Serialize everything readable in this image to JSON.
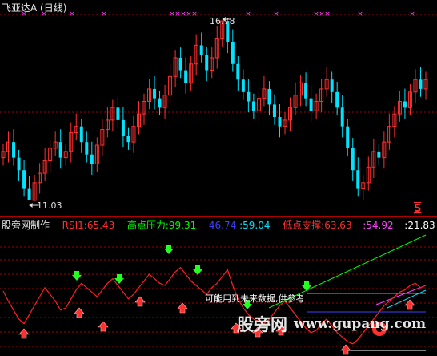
{
  "window": {
    "title": "飞亚达A (日线)"
  },
  "price_panel": {
    "high_label": "16.78",
    "low_label": "11.03",
    "s_marker": "S",
    "colors": {
      "up": "#ff3030",
      "down": "#00e5ff",
      "cross": "#ff40ff"
    }
  },
  "indicator_header": {
    "author": "股旁网制作",
    "rsi": {
      "label": "RSI1:",
      "value": "65.43",
      "color": "#ff3030"
    },
    "resist": {
      "label": "高点压力:",
      "value": "99.31",
      "color": "#00ff00"
    },
    "v3": {
      "value": "46.74",
      "color": "#4040ff"
    },
    "v4": {
      "value": ":59.04",
      "color": "#00e5ff"
    },
    "support": {
      "label": "低点支撑:",
      "value": "63.63",
      "color": "#ff3030"
    },
    "v6": {
      "value": ":54.92",
      "color": "#ff40ff"
    },
    "v7": {
      "value": ":21.83",
      "color": "#ffffff"
    }
  },
  "notice": "可能用到未来数据,供参考",
  "watermark": {
    "cn": "股旁网",
    "url": "www.gupang.com"
  },
  "chart_data": [
    {
      "type": "candlestick",
      "title": "飞亚达A (日线)",
      "annotations": [
        {
          "label": "16.78",
          "kind": "high"
        },
        {
          "label": "11.03",
          "kind": "low"
        }
      ],
      "series": [
        {
          "name": "daily",
          "values": [
            12.6,
            12.9,
            12.4,
            12.0,
            11.4,
            11.03,
            11.6,
            11.9,
            12.3,
            12.7,
            12.9,
            12.4,
            12.6,
            13.2,
            13.4,
            12.9,
            12.5,
            12.2,
            12.8,
            13.3,
            13.6,
            14.0,
            13.6,
            13.1,
            12.9,
            13.4,
            13.8,
            14.2,
            14.6,
            14.3,
            14.0,
            14.4,
            15.0,
            15.6,
            15.2,
            14.8,
            15.4,
            16.0,
            15.7,
            15.2,
            15.6,
            16.2,
            16.78,
            16.1,
            15.4,
            14.9,
            14.5,
            14.2,
            13.9,
            14.3,
            14.6,
            14.1,
            13.7,
            13.4,
            13.6,
            14.0,
            14.4,
            14.8,
            14.3,
            13.9,
            14.2,
            14.6,
            14.9,
            14.5,
            14.0,
            13.4,
            12.7,
            12.0,
            11.4,
            11.6,
            12.1,
            12.6,
            12.4,
            12.9,
            13.4,
            13.8,
            14.2,
            14.0,
            14.5,
            14.9,
            14.6,
            14.9
          ]
        }
      ]
    },
    {
      "type": "line",
      "title": "RSI1",
      "series": [
        {
          "name": "RSI1",
          "values": [
            55,
            46,
            38,
            30,
            26,
            34,
            42,
            50,
            58,
            52,
            46,
            38,
            40,
            48,
            56,
            62,
            58,
            54,
            50,
            56,
            62,
            66,
            60,
            54,
            48,
            52,
            58,
            64,
            70,
            66,
            62,
            60,
            66,
            72,
            76,
            70,
            64,
            60,
            56,
            52,
            58,
            62,
            68,
            74,
            60,
            48,
            40,
            34,
            30,
            28,
            26,
            30,
            36,
            42,
            46,
            40,
            34,
            28,
            22,
            18,
            20,
            26,
            30,
            24,
            18,
            14,
            10,
            8,
            12,
            18,
            24,
            30,
            36,
            42,
            46,
            50,
            54,
            56,
            60,
            62,
            58,
            60
          ]
        }
      ],
      "signals": {
        "up_count": 10,
        "down_count": 6
      }
    }
  ]
}
